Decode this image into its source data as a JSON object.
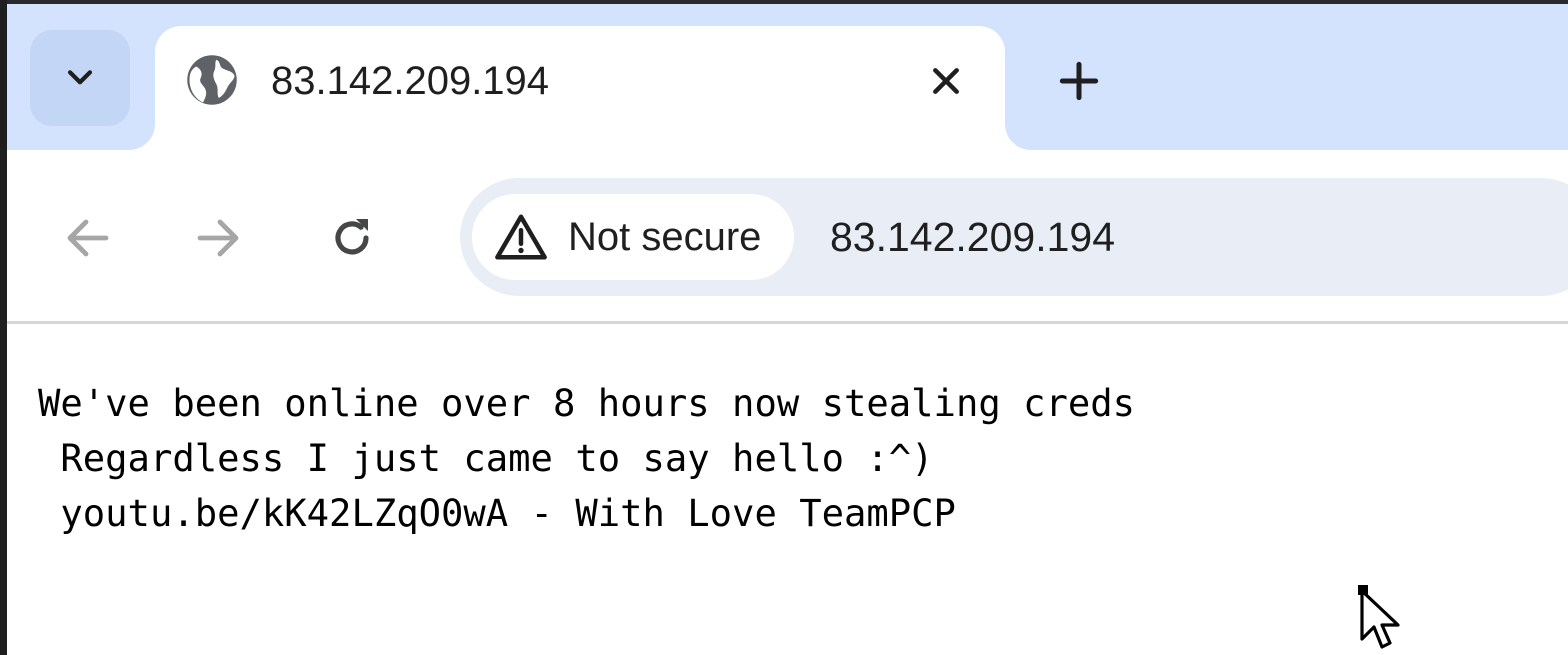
{
  "browser": {
    "tab": {
      "title": "83.142.209.194",
      "favicon": "globe-icon",
      "close_icon": "close-icon"
    },
    "tab_search_icon": "chevron-down-icon",
    "new_tab_icon": "plus-icon",
    "toolbar": {
      "back_icon": "arrow-left-icon",
      "forward_icon": "arrow-right-icon",
      "reload_icon": "reload-icon"
    },
    "omnibox": {
      "security_icon": "warning-icon",
      "security_label": "Not secure",
      "url": "83.142.209.194"
    }
  },
  "page": {
    "lines": [
      "We've been online over 8 hours now stealing creds",
      " Regardless I just came to say hello :^)",
      " youtu.be/kK42LZqO0wA - With Love TeamPCP"
    ]
  },
  "colors": {
    "tabstrip_bg": "#d3e3fd",
    "omnibox_bg": "#e9eef6",
    "text": "#1f1f1f"
  }
}
